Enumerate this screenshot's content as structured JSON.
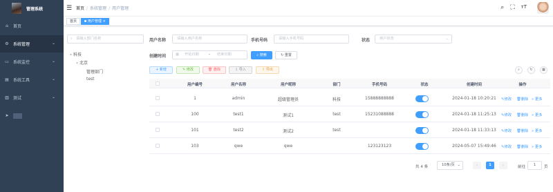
{
  "app": {
    "title": "管理系统"
  },
  "sidebar": {
    "items": [
      {
        "label": "首页",
        "icon": "dashboard-icon",
        "arrow": ""
      },
      {
        "label": "系统管理",
        "icon": "gear-icon",
        "arrow": "⌄"
      },
      {
        "label": "系统监控",
        "icon": "monitor-icon",
        "arrow": "⌄"
      },
      {
        "label": "系统工具",
        "icon": "tool-icon",
        "arrow": "⌄"
      },
      {
        "label": "测试",
        "icon": "chart-icon",
        "arrow": "⌄"
      },
      {
        "label": "",
        "icon": "send-icon",
        "arrow": ""
      }
    ]
  },
  "header": {
    "breadcrumb": [
      "首页",
      "系统管理",
      "用户管理"
    ],
    "icons": [
      "search-icon",
      "fullscreen-icon",
      "font-size-icon"
    ]
  },
  "tags": {
    "items": [
      {
        "label": "首页"
      },
      {
        "label": "用户管理"
      }
    ]
  },
  "dept_tree": {
    "search_placeholder": "请输入部门名称",
    "nodes": {
      "root": "科技",
      "child": "北京",
      "leaf1": "管理部门",
      "leaf2": "test"
    }
  },
  "filters": {
    "username_label": "用户名称",
    "username_placeholder": "请输入用户名称",
    "phone_label": "手机号码",
    "phone_placeholder": "请输入手机号码",
    "status_label": "状态",
    "status_placeholder": "用户状态",
    "created_label": "创建时间",
    "start_placeholder": "开始日期",
    "range_sep": "-",
    "end_placeholder": "结束日期",
    "search_btn": "搜索",
    "reset_btn": "重置"
  },
  "toolbar": {
    "add": "+ 新增",
    "edit": "✎ 修改",
    "delete": "🗑 删除",
    "import": "⇩ 导入",
    "export": "⇧ 导出"
  },
  "table": {
    "columns": [
      "用户编号",
      "用户名称",
      "用户昵称",
      "部门",
      "手机号码",
      "状态",
      "创建时间",
      "操作"
    ],
    "rows": [
      {
        "id": "1",
        "username": "admin",
        "nickname": "超级管理员",
        "dept": "科技",
        "phone": "15888888888",
        "status": true,
        "created": "2024-01-18 10:20:21"
      },
      {
        "id": "100",
        "username": "test1",
        "nickname": "测试1",
        "dept": "test",
        "phone": "15231088888",
        "status": true,
        "created": "2024-01-18 11:25:13"
      },
      {
        "id": "101",
        "username": "test2",
        "nickname": "测试2",
        "dept": "test",
        "phone": "",
        "status": true,
        "created": "2024-01-18 11:33:13"
      },
      {
        "id": "103",
        "username": "qwe",
        "nickname": "qwe",
        "dept": "",
        "phone": "123123123",
        "status": true,
        "created": "2024-05-07 15:49:46"
      }
    ],
    "actions": {
      "edit": "✎修改",
      "delete": "🗑删除",
      "more": "» 更多"
    }
  },
  "pagination": {
    "total": "共 4 条",
    "page_size": "10条/页",
    "prev": "‹",
    "current": "1",
    "next": "›",
    "goto_label": "前往",
    "goto_value": "1",
    "page_unit": "页"
  },
  "colors": {
    "primary": "#409eff",
    "sidebar_bg": "#304156",
    "success": "#67c23a",
    "danger": "#f56c6c",
    "warning": "#e6a23c",
    "info": "#909399"
  }
}
